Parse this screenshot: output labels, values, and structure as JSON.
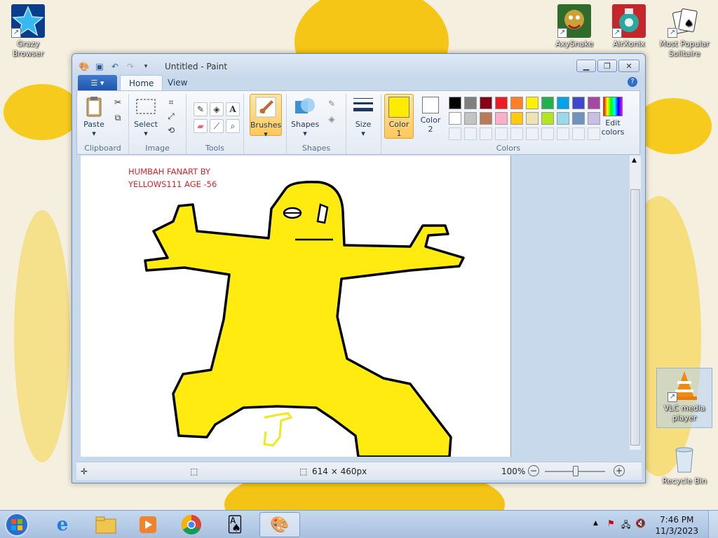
{
  "desktop": {
    "icons": [
      {
        "label": "Grazy Browser"
      },
      {
        "label": "AxySnake"
      },
      {
        "label": "AirXonix"
      },
      {
        "label": "Most Popular Solitaire"
      },
      {
        "label": "VLC media player"
      },
      {
        "label": "Recycle Bin"
      }
    ]
  },
  "window": {
    "title": "Untitled - Paint",
    "tabs": [
      {
        "label": "Home"
      },
      {
        "label": "View"
      }
    ],
    "help_glyph": "?",
    "ribbon": {
      "clipboard": {
        "paste": "Paste",
        "label": "Clipboard"
      },
      "image": {
        "select": "Select",
        "label": "Image"
      },
      "tools": {
        "label": "Tools",
        "text_glyph": "A"
      },
      "brushes": {
        "label": "Brushes"
      },
      "shapes": {
        "shapes": "Shapes",
        "label": "Shapes"
      },
      "size": {
        "label": "Size"
      },
      "colors": {
        "color1": "Color",
        "color1_num": "1",
        "color2": "Color",
        "color2_num": "2",
        "edit": "Edit",
        "edit2": "colors",
        "label": "Colors",
        "color1_value": "#ffeb00",
        "color2_value": "#ffffff",
        "palette_row1": [
          "#000000",
          "#7f7f7f",
          "#880015",
          "#ed1c24",
          "#ff7f27",
          "#fff200",
          "#22b14c",
          "#00a2e8",
          "#3f48cc",
          "#a349a4"
        ],
        "palette_row2": [
          "#ffffff",
          "#c3c3c3",
          "#b97a57",
          "#ffaec9",
          "#ffc90e",
          "#efe4b0",
          "#b5e61d",
          "#99d9ea",
          "#7092be",
          "#c8bfe7"
        ]
      }
    },
    "canvas": {
      "text_line1": "HUMBAH FANART BY",
      "text_line2": "YELLOWS111 AGE -56"
    },
    "status": {
      "size": "614 × 460px",
      "zoom": "100%"
    }
  },
  "taskbar": {
    "time": "7:46 PM",
    "date": "11/3/2023"
  }
}
